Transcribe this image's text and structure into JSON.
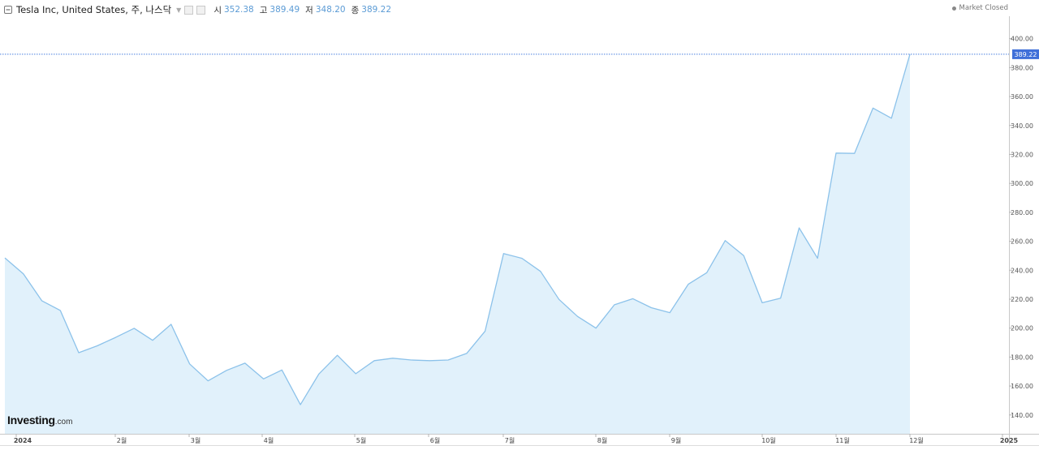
{
  "header": {
    "title": "Tesla Inc, United States, 주, 나스닥",
    "open_label": "시",
    "open_value": "352.38",
    "high_label": "고",
    "high_value": "389.49",
    "low_label": "저",
    "low_value": "348.20",
    "close_label": "종",
    "close_value": "389.22"
  },
  "market_status": "Market Closed",
  "logo": {
    "main": "Investing",
    "sub": ".com"
  },
  "colors": {
    "line": "#8cc2ea",
    "fill": "#e1f1fb",
    "last_price_line": "#4a7fe0",
    "last_price_badge": "#3f6fd9",
    "header_value": "#5b9bd5"
  },
  "chart_data": {
    "type": "area",
    "instrument": "Tesla Inc",
    "x_tick_labels": [
      "2024",
      "2월",
      "3월",
      "4월",
      "5월",
      "6월",
      "7월",
      "8월",
      "9월",
      "10월",
      "11월",
      "12월",
      "2025"
    ],
    "y_tick_labels": [
      "140.00",
      "160.00",
      "180.00",
      "200.00",
      "220.00",
      "240.00",
      "260.00",
      "280.00",
      "300.00",
      "320.00",
      "340.00",
      "360.00",
      "380.00",
      "400.00"
    ],
    "y_ticks": [
      140,
      160,
      180,
      200,
      220,
      240,
      260,
      280,
      300,
      320,
      340,
      360,
      380,
      400
    ],
    "ylim": [
      127,
      411
    ],
    "last_price": 389.22,
    "last_price_label": "389.22",
    "grid": false,
    "series": [
      {
        "values": [
          248.5,
          237.5,
          218.9,
          212.2,
          183.0,
          187.8,
          193.6,
          199.9,
          191.6,
          202.6,
          175.3,
          163.6,
          170.8,
          175.8,
          164.9,
          171.1,
          147.1,
          168.3,
          181.2,
          168.5,
          177.5,
          179.2,
          178.0,
          177.5,
          178.0,
          182.5,
          197.9,
          251.5,
          248.2,
          239.2,
          219.8,
          208.1,
          200.0,
          216.1,
          220.3,
          214.1,
          210.7,
          230.3,
          238.3,
          260.5,
          250.1,
          217.5,
          220.7,
          269.2,
          248.3,
          320.9,
          320.7,
          352.0,
          345.0,
          389.22
        ]
      }
    ]
  }
}
